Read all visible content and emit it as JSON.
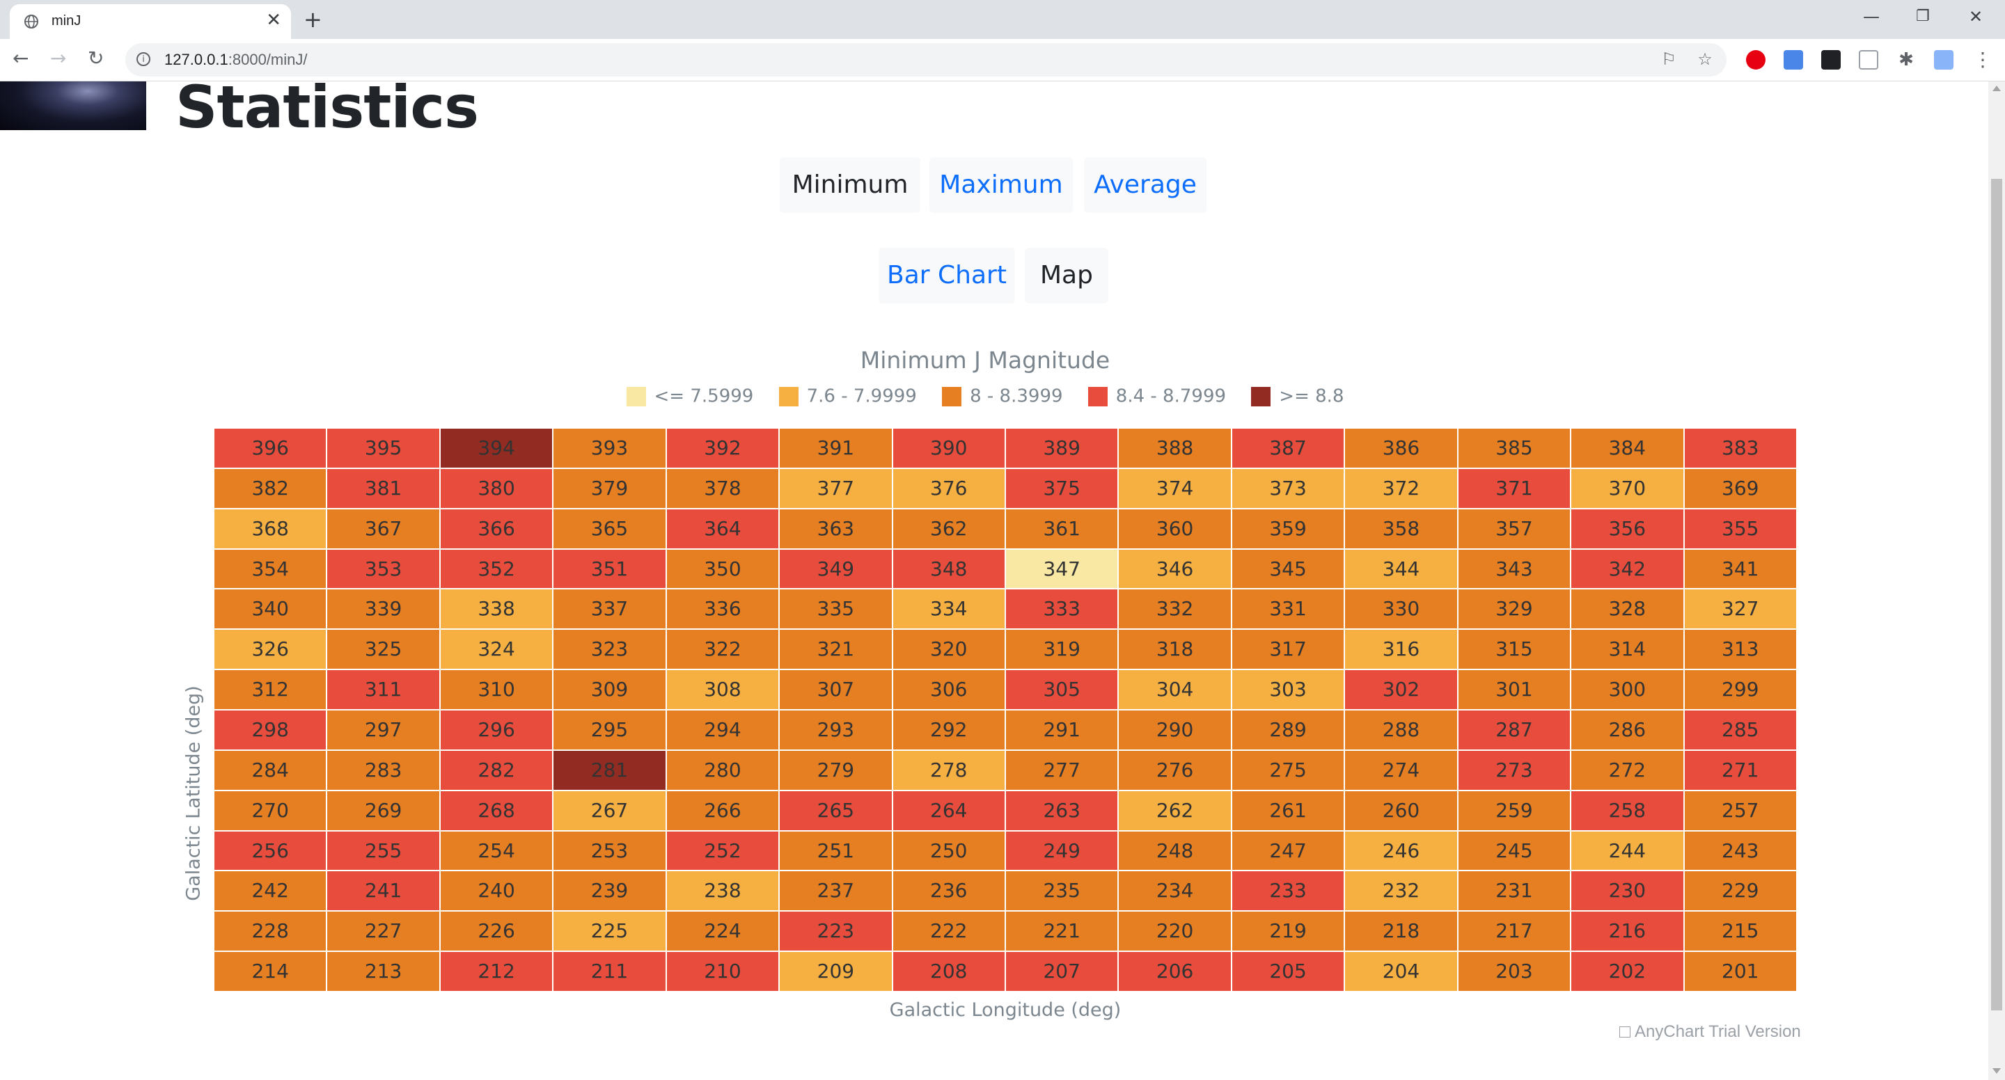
{
  "browser": {
    "tab_title": "minJ",
    "url_host": "127.0.0.1",
    "url_path": ":8000/minJ/"
  },
  "page": {
    "title": "Statistics",
    "stat_buttons": [
      "Minimum",
      "Maximum",
      "Average"
    ],
    "view_buttons": [
      "Bar Chart",
      "Map"
    ],
    "credit": "AnyChart Trial Version"
  },
  "colors": {
    "c0": "#f9e8a4",
    "c1": "#f5b041",
    "c2": "#e67e22",
    "c3": "#e74c3c",
    "c4": "#922b21"
  },
  "chart_data": {
    "type": "heatmap",
    "title": "Minimum J Magnitude",
    "xlabel": "Galactic Longitude (deg)",
    "ylabel": "Galactic Latitude (deg)",
    "legend": [
      {
        "label": "<= 7.5999",
        "color": "#f9e8a4"
      },
      {
        "label": "7.6 - 7.9999",
        "color": "#f5b041"
      },
      {
        "label": "8 - 8.3999",
        "color": "#e67e22"
      },
      {
        "label": "8.4 - 8.7999",
        "color": "#e74c3c"
      },
      {
        "label": ">= 8.8",
        "color": "#922b21"
      }
    ],
    "columns": 14,
    "rows": [
      {
        "labels": [
          396,
          395,
          394,
          393,
          392,
          391,
          390,
          389,
          388,
          387,
          386,
          385,
          384,
          383
        ],
        "bins": [
          3,
          3,
          4,
          2,
          3,
          2,
          3,
          3,
          2,
          3,
          2,
          2,
          2,
          3
        ]
      },
      {
        "labels": [
          382,
          381,
          380,
          379,
          378,
          377,
          376,
          375,
          374,
          373,
          372,
          371,
          370,
          369
        ],
        "bins": [
          2,
          3,
          3,
          2,
          2,
          1,
          1,
          3,
          1,
          1,
          1,
          3,
          1,
          2
        ]
      },
      {
        "labels": [
          368,
          367,
          366,
          365,
          364,
          363,
          362,
          361,
          360,
          359,
          358,
          357,
          356,
          355
        ],
        "bins": [
          1,
          2,
          3,
          2,
          3,
          2,
          2,
          2,
          2,
          2,
          2,
          2,
          3,
          3
        ]
      },
      {
        "labels": [
          354,
          353,
          352,
          351,
          350,
          349,
          348,
          347,
          346,
          345,
          344,
          343,
          342,
          341
        ],
        "bins": [
          2,
          3,
          3,
          3,
          2,
          3,
          3,
          0,
          1,
          2,
          1,
          2,
          3,
          2
        ]
      },
      {
        "labels": [
          340,
          339,
          338,
          337,
          336,
          335,
          334,
          333,
          332,
          331,
          330,
          329,
          328,
          327
        ],
        "bins": [
          2,
          2,
          1,
          2,
          2,
          2,
          1,
          3,
          2,
          2,
          2,
          2,
          2,
          1
        ]
      },
      {
        "labels": [
          326,
          325,
          324,
          323,
          322,
          321,
          320,
          319,
          318,
          317,
          316,
          315,
          314,
          313
        ],
        "bins": [
          1,
          2,
          1,
          2,
          2,
          2,
          2,
          2,
          2,
          2,
          1,
          2,
          2,
          2
        ]
      },
      {
        "labels": [
          312,
          311,
          310,
          309,
          308,
          307,
          306,
          305,
          304,
          303,
          302,
          301,
          300,
          299
        ],
        "bins": [
          2,
          3,
          2,
          2,
          1,
          2,
          2,
          3,
          1,
          1,
          3,
          2,
          2,
          2
        ]
      },
      {
        "labels": [
          298,
          297,
          296,
          295,
          294,
          293,
          292,
          291,
          290,
          289,
          288,
          287,
          286,
          285
        ],
        "bins": [
          3,
          2,
          3,
          2,
          2,
          2,
          2,
          2,
          2,
          2,
          2,
          3,
          2,
          3
        ]
      },
      {
        "labels": [
          284,
          283,
          282,
          281,
          280,
          279,
          278,
          277,
          276,
          275,
          274,
          273,
          272,
          271
        ],
        "bins": [
          2,
          2,
          3,
          4,
          2,
          2,
          1,
          2,
          2,
          2,
          2,
          3,
          2,
          3
        ]
      },
      {
        "labels": [
          270,
          269,
          268,
          267,
          266,
          265,
          264,
          263,
          262,
          261,
          260,
          259,
          258,
          257
        ],
        "bins": [
          2,
          2,
          3,
          1,
          2,
          3,
          3,
          3,
          1,
          2,
          2,
          2,
          3,
          2
        ]
      },
      {
        "labels": [
          256,
          255,
          254,
          253,
          252,
          251,
          250,
          249,
          248,
          247,
          246,
          245,
          244,
          243
        ],
        "bins": [
          3,
          3,
          2,
          2,
          3,
          2,
          2,
          3,
          2,
          2,
          1,
          2,
          1,
          2
        ]
      },
      {
        "labels": [
          242,
          241,
          240,
          239,
          238,
          237,
          236,
          235,
          234,
          233,
          232,
          231,
          230,
          229
        ],
        "bins": [
          2,
          3,
          2,
          2,
          1,
          2,
          2,
          2,
          2,
          3,
          1,
          2,
          3,
          2
        ]
      },
      {
        "labels": [
          228,
          227,
          226,
          225,
          224,
          223,
          222,
          221,
          220,
          219,
          218,
          217,
          216,
          215
        ],
        "bins": [
          2,
          2,
          2,
          1,
          2,
          3,
          2,
          2,
          2,
          2,
          2,
          2,
          3,
          2
        ]
      },
      {
        "labels": [
          214,
          213,
          212,
          211,
          210,
          209,
          208,
          207,
          206,
          205,
          204,
          203,
          202,
          201
        ],
        "bins": [
          2,
          2,
          3,
          3,
          3,
          1,
          3,
          3,
          3,
          3,
          1,
          2,
          3,
          2
        ]
      }
    ]
  }
}
